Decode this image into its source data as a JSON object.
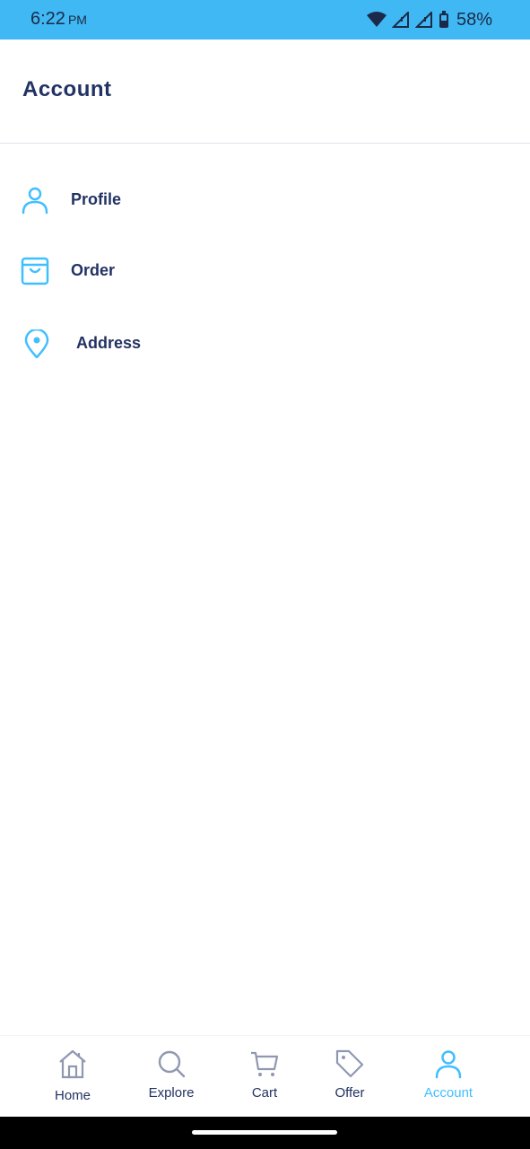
{
  "status_bar": {
    "time": "6:22",
    "ampm": "PM",
    "battery": "58%",
    "icons": [
      "wifi-icon",
      "signal-icon",
      "signal-icon",
      "battery-icon"
    ]
  },
  "header": {
    "title": "Account"
  },
  "menu": {
    "items": [
      {
        "label": "Profile",
        "icon": "user-icon"
      },
      {
        "label": "Order",
        "icon": "bag-icon"
      },
      {
        "label": "Address",
        "icon": "location-icon"
      }
    ]
  },
  "bottom_nav": {
    "items": [
      {
        "label": "Home",
        "icon": "home-icon"
      },
      {
        "label": "Explore",
        "icon": "search-icon"
      },
      {
        "label": "Cart",
        "icon": "cart-icon"
      },
      {
        "label": "Offer",
        "icon": "tag-icon"
      },
      {
        "label": "Account",
        "icon": "user-icon",
        "active": true
      }
    ]
  },
  "colors": {
    "accent": "#40bfff",
    "text": "#223263",
    "status_bar": "#40b8f4",
    "muted_icon": "#9098b1"
  }
}
